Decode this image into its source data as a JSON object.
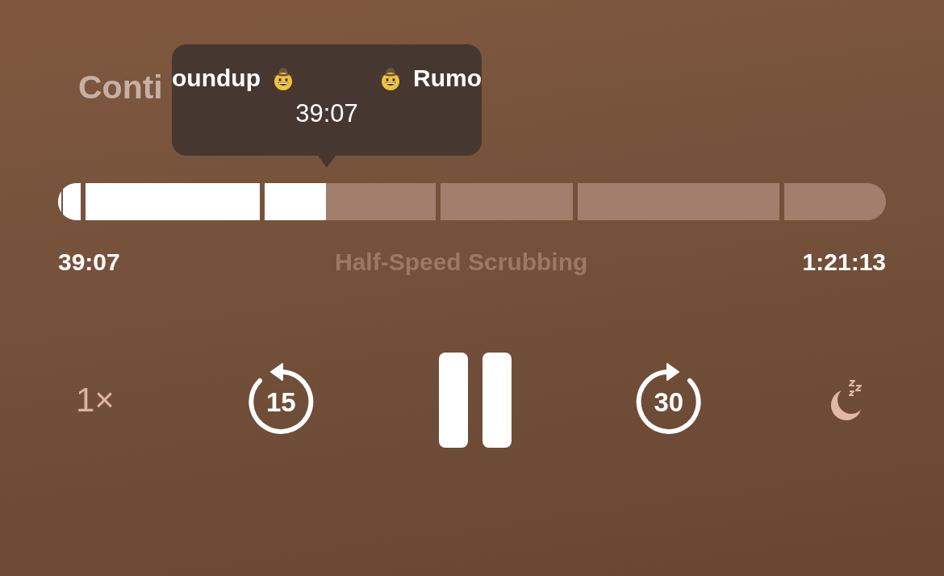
{
  "now_playing": {
    "heading": "Conti"
  },
  "tooltip": {
    "chapter_left": "oundup",
    "chapter_right": "Rumo",
    "time": "39:07"
  },
  "elapsed": "39:07",
  "mode": "Half-Speed Scrubbing",
  "remaining": "1:21:13",
  "controls": {
    "speed": "1×",
    "skip_back": "15",
    "skip_forward": "30",
    "playing": true
  }
}
